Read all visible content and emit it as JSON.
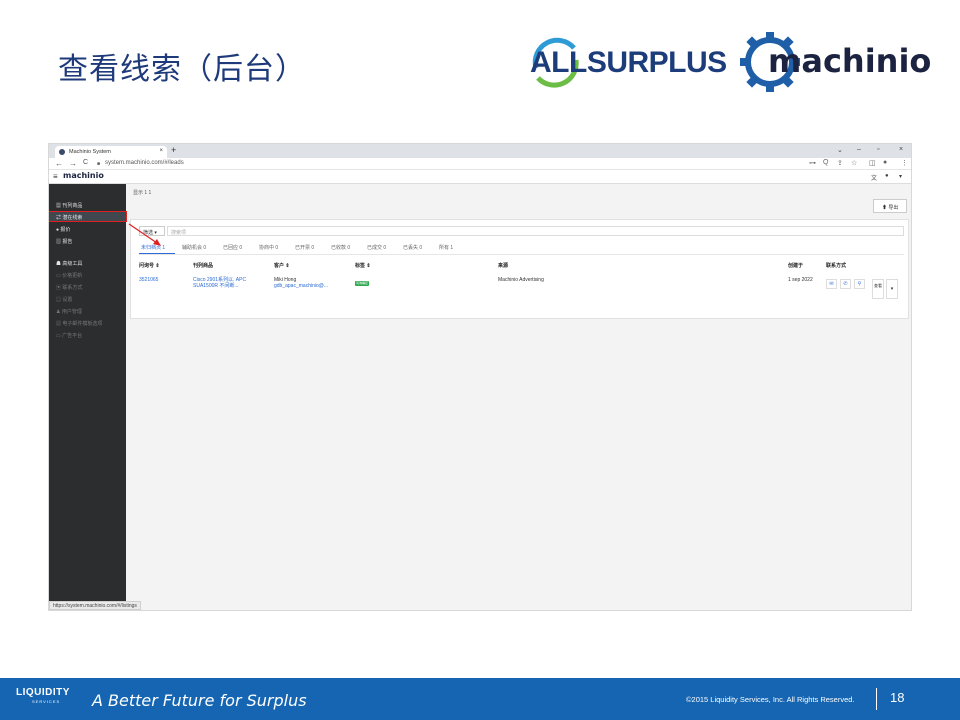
{
  "slide": {
    "title": "查看线索（后台）",
    "logos": {
      "allsurplus": "ALLSURPLUS",
      "machinio": "machinio"
    }
  },
  "browser": {
    "tab_title": "Machinio System",
    "tab_close": "×",
    "new_tab": "+",
    "window_controls": [
      "⌄",
      "–",
      "▫",
      "×"
    ],
    "url": "system.machinio.com/#/leads",
    "nav": {
      "back": "←",
      "forward": "→",
      "reload": "C"
    },
    "address_icons": [
      "⊶",
      "Q",
      "⇪",
      "☆",
      "◫",
      "●",
      "⋮"
    ],
    "status_url": "https://system.machinio.com/#/listings"
  },
  "app": {
    "logo": "machinio",
    "menu_icon": "≡",
    "header_icons": [
      "文",
      "●",
      "▾"
    ],
    "sidebar": [
      {
        "label": "刊列商品",
        "icon": "▦",
        "state": "normal"
      },
      {
        "label": "潜在线索",
        "icon": "⇄",
        "state": "active"
      },
      {
        "label": "报价",
        "icon": "●",
        "state": "normal"
      },
      {
        "label": "报告",
        "icon": "▥",
        "state": "normal"
      },
      {
        "label": "高级工具",
        "icon": "☗",
        "state": "normal"
      },
      {
        "label": "价格更新",
        "icon": "▭",
        "state": "dim"
      },
      {
        "label": "联系方式",
        "icon": "▣",
        "state": "dim"
      },
      {
        "label": "设置",
        "icon": "▤",
        "state": "dim"
      },
      {
        "label": "用户管理",
        "icon": "♟",
        "state": "dim"
      },
      {
        "label": "电子邮件模板选项",
        "icon": "▧",
        "state": "dim"
      },
      {
        "label": "广告平台",
        "icon": "▭",
        "state": "dim"
      }
    ],
    "breadcrumb": "显示 1 1",
    "export_label": "⬆ 导出",
    "filter_label": "筛选",
    "filter_placeholder": "搜索项",
    "status_tabs": [
      {
        "label": "未归档页",
        "count": "1",
        "active": true
      },
      {
        "label": "辅助机会",
        "count": "0",
        "active": false
      },
      {
        "label": "已回应",
        "count": "0",
        "active": false
      },
      {
        "label": "协商中",
        "count": "0",
        "active": false
      },
      {
        "label": "已开票",
        "count": "0",
        "active": false
      },
      {
        "label": "已收款",
        "count": "0",
        "active": false
      },
      {
        "label": "已成交",
        "count": "0",
        "active": false
      },
      {
        "label": "已丢失",
        "count": "0",
        "active": false
      },
      {
        "label": "所有",
        "count": "1",
        "active": false
      }
    ],
    "table": {
      "headers": {
        "id": "问询号 ⇕",
        "product": "刊列商品",
        "customer": "客户 ⇕",
        "label": "标签 ⇕",
        "source": "来源",
        "created": "创建于",
        "contact": "联系方式"
      },
      "rows": [
        {
          "id": "3521065",
          "product_line1": "Cisco 2901系列以. APC",
          "product_line2": "SUA1500R 不间断...",
          "customer_name": "Miki Hong",
          "customer_email": "gdb_apac_machinio@...",
          "tag": "问询确定",
          "source": "Machinio Advertising",
          "created": "1 sep 2022",
          "actions": [
            "✉",
            "✆",
            "⚲"
          ],
          "more": "查看",
          "caret": "▾"
        }
      ]
    }
  },
  "footer": {
    "logo": "LIQUIDITY",
    "logo_sub": "SERVICES",
    "tagline": "A Better Future for Surplus",
    "copyright": "©2015 Liquidity Services, Inc. All Rights Reserved.",
    "page_number": "18"
  },
  "colors": {
    "title": "#1f3a7a",
    "footer_bg": "#1565b2",
    "sidebar_bg": "#2b2d2f",
    "link": "#2a6bd6",
    "tag": "#2fa84f",
    "highlight": "#e02020"
  }
}
